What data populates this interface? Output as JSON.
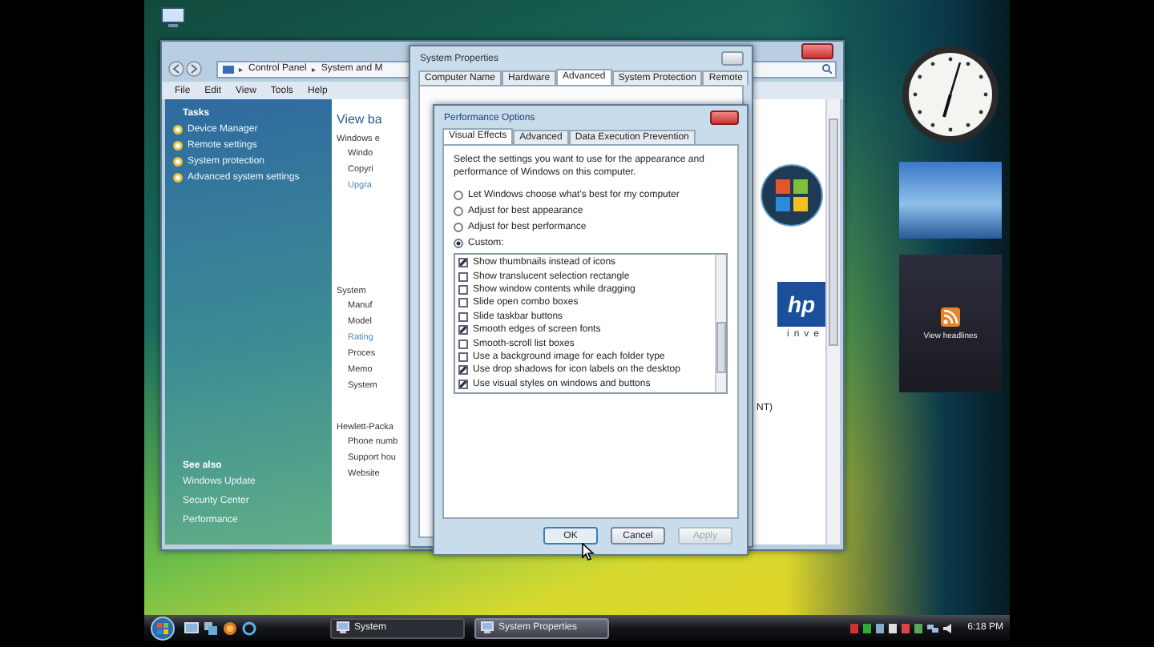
{
  "control_panel": {
    "breadcrumb": [
      {
        "arrow": "▸",
        "label": "Control Panel"
      },
      {
        "arrow": "▸",
        "label": "System and M"
      }
    ],
    "menu": [
      "File",
      "Edit",
      "View",
      "Tools",
      "Help"
    ],
    "tasks_heading": "Tasks",
    "tasks": [
      "Device Manager",
      "Remote settings",
      "System protection",
      "Advanced system settings"
    ],
    "see_also_heading": "See also",
    "see_also": [
      "Windows Update",
      "Security Center",
      "Performance"
    ],
    "page_title": "View ba",
    "groups": [
      {
        "heading": "Windows e",
        "items": [
          {
            "text": "Windo",
            "kind": "text"
          },
          {
            "text": "Copyri",
            "kind": "text"
          },
          {
            "text": "Upgra",
            "kind": "link"
          }
        ]
      },
      {
        "heading": "System",
        "items": [
          {
            "text": "Manuf",
            "kind": "text"
          },
          {
            "text": "Model",
            "kind": "text"
          },
          {
            "text": "Rating",
            "kind": "link"
          },
          {
            "text": "Proces",
            "kind": "text"
          },
          {
            "text": "Memo",
            "kind": "text"
          },
          {
            "text": "System",
            "kind": "text"
          }
        ]
      },
      {
        "heading": "Hewlett-Packa",
        "items": [
          {
            "text": "Phone numb",
            "kind": "text"
          },
          {
            "text": "Support hou",
            "kind": "text"
          },
          {
            "text": "Website",
            "kind": "text"
          }
        ]
      }
    ],
    "brand_mark": "hp",
    "brand_caption": "inve",
    "note": "NT)"
  },
  "system_properties": {
    "title": "System Properties",
    "tabs": [
      {
        "label": "Computer Name",
        "selected": false
      },
      {
        "label": "Hardware",
        "selected": false
      },
      {
        "label": "Advanced",
        "selected": true
      },
      {
        "label": "System Protection",
        "selected": false
      },
      {
        "label": "Remote",
        "selected": false
      }
    ]
  },
  "performance_options": {
    "title": "Performance Options",
    "tabs": [
      {
        "label": "Visual Effects",
        "selected": true
      },
      {
        "label": "Advanced",
        "selected": false
      },
      {
        "label": "Data Execution Prevention",
        "selected": false
      }
    ],
    "description": "Select the settings you want to use for the appearance and performance of Windows on this computer.",
    "options": [
      {
        "label": "Let Windows choose what's best for my computer",
        "selected": false
      },
      {
        "label": "Adjust for best appearance",
        "selected": false
      },
      {
        "label": "Adjust for best performance",
        "selected": false
      },
      {
        "label": "Custom:",
        "selected": true
      }
    ],
    "effects": [
      {
        "label": "Show thumbnails instead of icons",
        "checked": true
      },
      {
        "label": "Show translucent selection rectangle",
        "checked": false
      },
      {
        "label": "Show window contents while dragging",
        "checked": false
      },
      {
        "label": "Slide open combo boxes",
        "checked": false
      },
      {
        "label": "Slide taskbar buttons",
        "checked": false
      },
      {
        "label": "Smooth edges of screen fonts",
        "checked": true
      },
      {
        "label": "Smooth-scroll list boxes",
        "checked": false
      },
      {
        "label": "Use a background image for each folder type",
        "checked": false
      },
      {
        "label": "Use drop shadows for icon labels on the desktop",
        "checked": true
      },
      {
        "label": "Use visual styles on windows and buttons",
        "checked": true
      }
    ],
    "buttons": [
      {
        "label": "OK",
        "disabled": false
      },
      {
        "label": "Cancel",
        "disabled": false
      },
      {
        "label": "Apply",
        "disabled": true
      }
    ]
  },
  "gadgets": {
    "feed_label": "View headlines"
  },
  "taskbar": {
    "tasks": [
      {
        "label": "System",
        "selected": false
      },
      {
        "label": "System Properties",
        "selected": true
      }
    ],
    "clock": "6:18 PM"
  }
}
